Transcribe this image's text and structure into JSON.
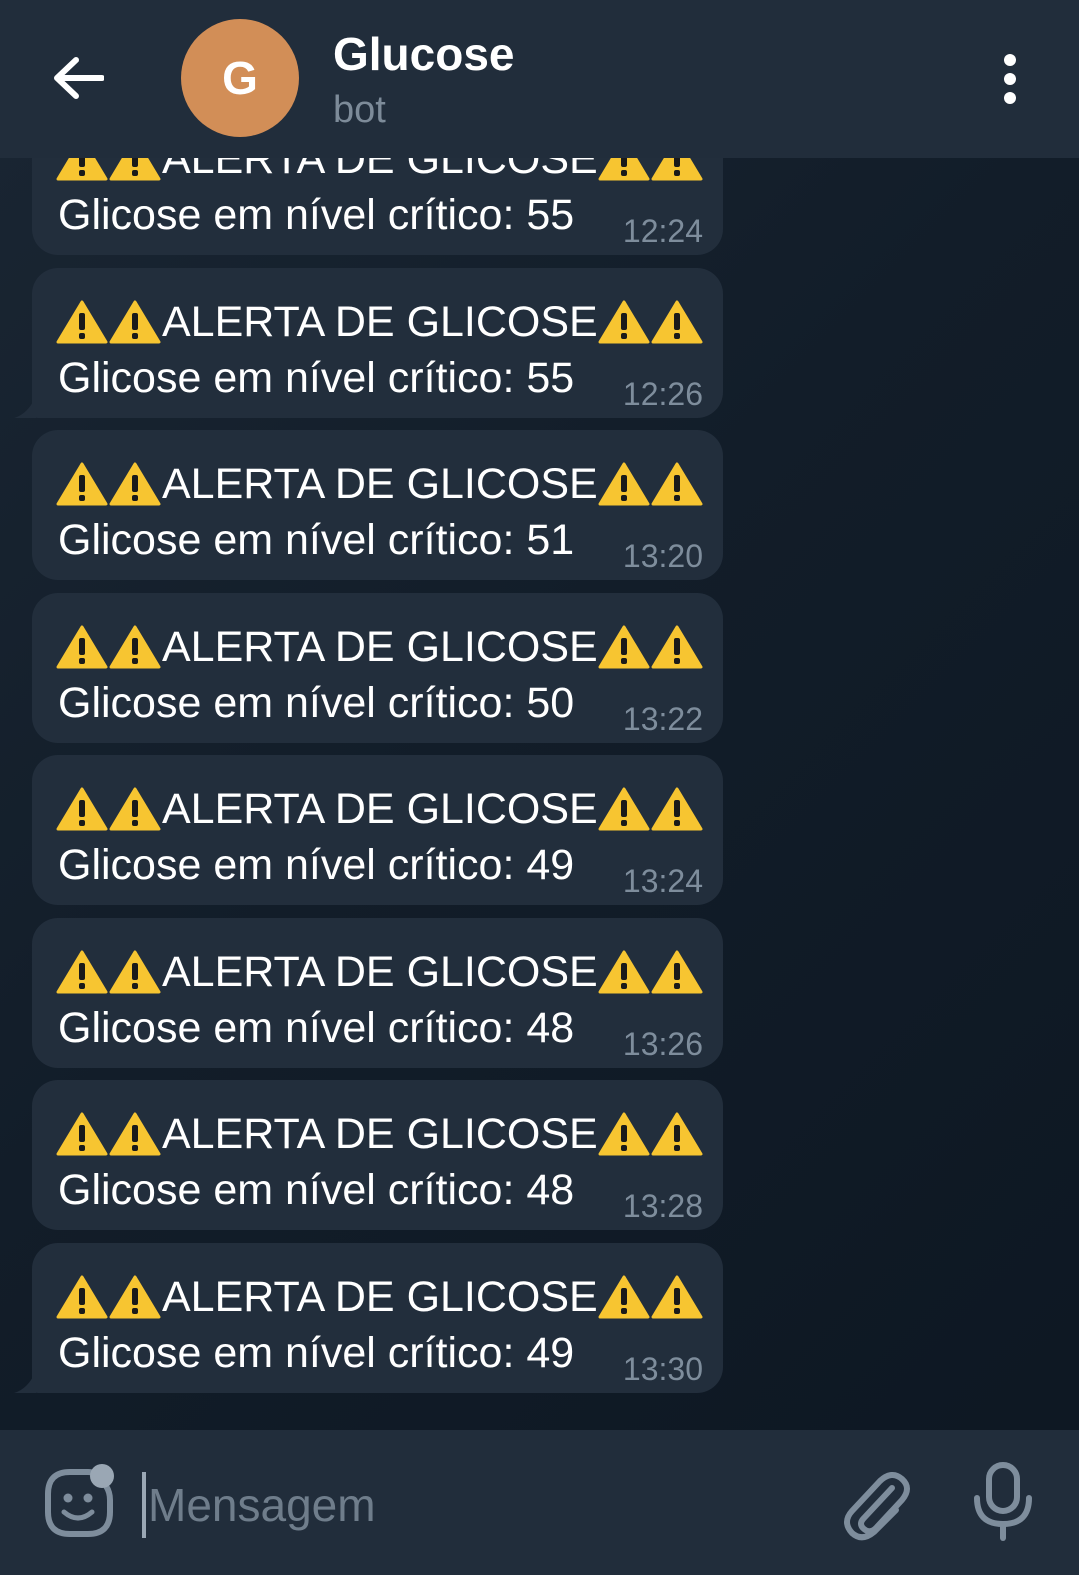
{
  "header": {
    "back_icon": "arrow-left-icon",
    "avatar_letter": "G",
    "avatar_color": "#d28e57",
    "title": "Glucose",
    "subtitle": "bot",
    "menu_icon": "more-vertical-icon"
  },
  "messages": [
    {
      "title": "ALERTA DE GLICOSE",
      "text": "Glicose em nível crítico: 55",
      "time": "12:24"
    },
    {
      "title": "ALERTA DE GLICOSE",
      "text": "Glicose em nível crítico: 55",
      "time": "12:26"
    },
    {
      "title": "ALERTA DE GLICOSE",
      "text": "Glicose em nível crítico: 51",
      "time": "13:20"
    },
    {
      "title": "ALERTA DE GLICOSE",
      "text": "Glicose em nível crítico: 50",
      "time": "13:22"
    },
    {
      "title": "ALERTA DE GLICOSE",
      "text": "Glicose em nível crítico: 49",
      "time": "13:24"
    },
    {
      "title": "ALERTA DE GLICOSE",
      "text": "Glicose em nível crítico: 48",
      "time": "13:26"
    },
    {
      "title": "ALERTA DE GLICOSE",
      "text": "Glicose em nível crítico: 48",
      "time": "13:28"
    },
    {
      "title": "ALERTA DE GLICOSE",
      "text": "Glicose em nível crítico: 49",
      "time": "13:30"
    }
  ],
  "input": {
    "placeholder": "Mensagem",
    "value": ""
  },
  "colors": {
    "header_bg": "#212d3b",
    "bubble_bg": "#222e3c",
    "warning_yellow": "#f7c531",
    "muted_text": "#7e8d9c"
  }
}
